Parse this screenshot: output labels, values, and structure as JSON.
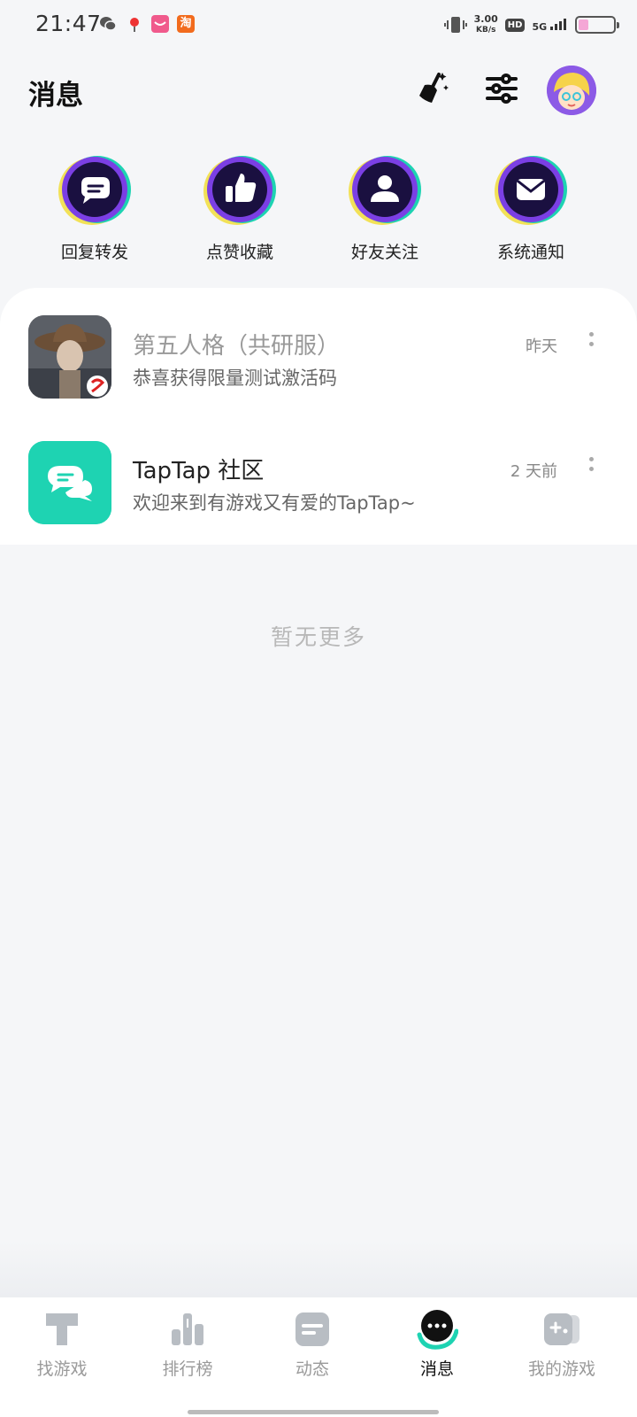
{
  "status_bar": {
    "time": "21:47",
    "net_speed_value": "3.00",
    "net_speed_unit": "KB/s",
    "hd": "HD",
    "signal": "5G",
    "battery_level": 0.25,
    "apps": [
      "wechat-icon",
      "maps-pin-icon",
      "pink-app-icon",
      "taobao-icon"
    ],
    "taobao_char": "淘"
  },
  "header": {
    "title": "消息",
    "icons": [
      "clean-broom-icon",
      "filter-settings-icon"
    ]
  },
  "categories": [
    {
      "label": "回复转发",
      "icon": "reply-chat-icon"
    },
    {
      "label": "点赞收藏",
      "icon": "thumbs-up-icon"
    },
    {
      "label": "好友关注",
      "icon": "friend-person-icon"
    },
    {
      "label": "系统通知",
      "icon": "mail-envelope-icon"
    }
  ],
  "messages": [
    {
      "title": "第五人格（共研服）",
      "subtitle": "恭喜获得限量测试激活码",
      "time": "昨天"
    },
    {
      "title": "TapTap 社区",
      "subtitle": "欢迎来到有游戏又有爱的TapTap~",
      "time": "2 天前"
    }
  ],
  "footer_text": "暂无更多",
  "bottom_nav": [
    {
      "label": "找游戏",
      "icon": "find-game-icon",
      "active": false
    },
    {
      "label": "排行榜",
      "icon": "ranking-icon",
      "active": false
    },
    {
      "label": "动态",
      "icon": "feed-icon",
      "active": false
    },
    {
      "label": "消息",
      "icon": "message-icon",
      "active": true
    },
    {
      "label": "我的游戏",
      "icon": "my-games-icon",
      "active": false
    }
  ],
  "colors": {
    "accent": "#1ed3b2",
    "ring_purple": "#7b3fe4",
    "ring_yellow": "#f2e157",
    "badge_bg": "#1a1040",
    "page_bg": "#f5f6f8"
  }
}
